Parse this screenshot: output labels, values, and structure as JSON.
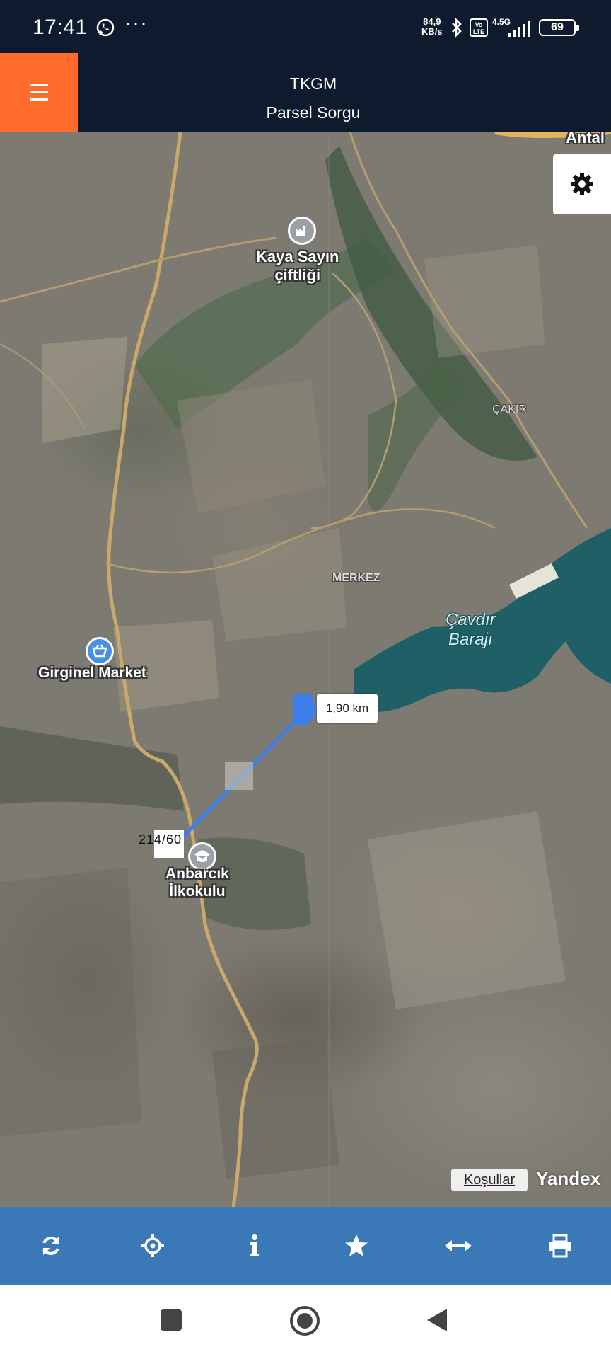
{
  "status_bar": {
    "time": "17:41",
    "dots": "···",
    "speed_value": "84,9",
    "speed_unit": "KB/s",
    "volte": "Vo LTE",
    "network": "4.5G",
    "battery": "69"
  },
  "header": {
    "title": "TKGM",
    "subtitle": "Parsel Sorgu",
    "accent_color": "#ff6b2b",
    "background_color": "#0e1b2e"
  },
  "map": {
    "labels": {
      "farm": "Kaya Sayın\nçiftliği",
      "cakir": "ÇAKIR",
      "merkez": "MERKEZ",
      "dam": "Çavdır\nBarajı",
      "market": "Girginel Market",
      "school": "Anbarcık\nİlkokulu",
      "antal": "Antal"
    },
    "distance": "1,90 km",
    "parcel": "214/60",
    "attribution": "Koşullar",
    "provider": "Yandex"
  },
  "toolbar": {
    "color": "#3b78b8",
    "buttons": [
      "refresh-icon",
      "locate-icon",
      "info-icon",
      "star-icon",
      "measure-icon",
      "print-icon"
    ]
  },
  "nav_bar": {
    "buttons": [
      "recents-icon",
      "home-icon",
      "back-icon"
    ]
  }
}
